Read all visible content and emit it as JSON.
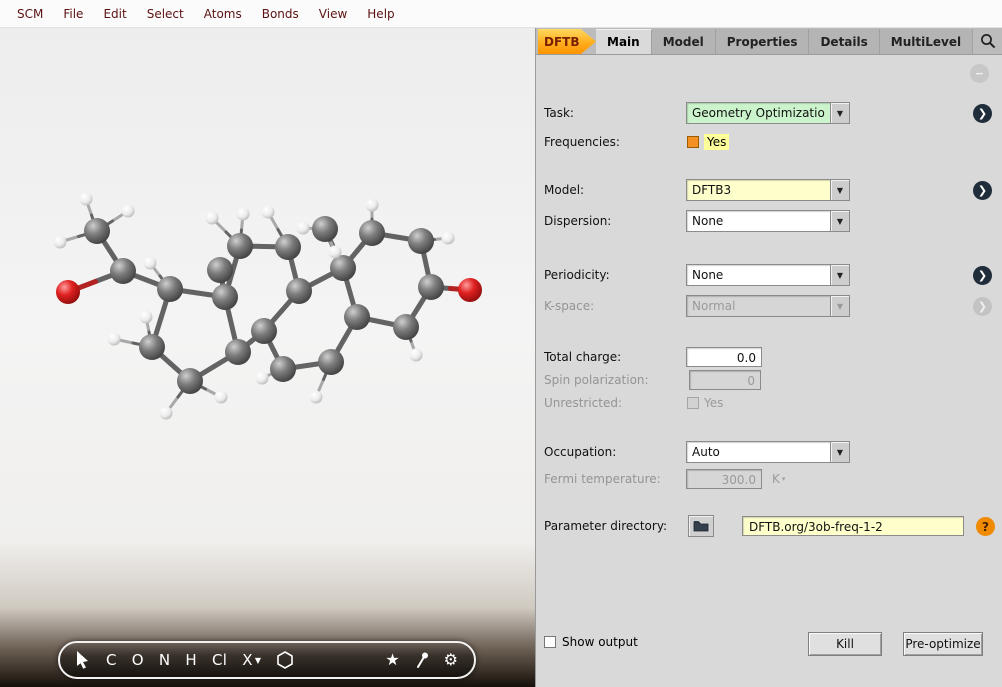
{
  "menu": {
    "items": [
      "SCM",
      "File",
      "Edit",
      "Select",
      "Atoms",
      "Bonds",
      "View",
      "Help"
    ]
  },
  "tabs": {
    "dftb_label": "DFTB",
    "items": [
      {
        "label": "Main",
        "active": true
      },
      {
        "label": "Model",
        "active": false
      },
      {
        "label": "Properties",
        "active": false
      },
      {
        "label": "Details",
        "active": false
      },
      {
        "label": "MultiLevel",
        "active": false
      }
    ]
  },
  "form": {
    "task": {
      "label": "Task:",
      "value": "Geometry Optimizatio"
    },
    "frequencies": {
      "label": "Frequencies:",
      "value": "Yes",
      "checked": true
    },
    "model": {
      "label": "Model:",
      "value": "DFTB3"
    },
    "dispersion": {
      "label": "Dispersion:",
      "value": "None"
    },
    "periodicity": {
      "label": "Periodicity:",
      "value": "None"
    },
    "kspace": {
      "label": "K-space:",
      "value": "Normal",
      "disabled": true
    },
    "total_charge": {
      "label": "Total charge:",
      "value": "0.0"
    },
    "spin_polarization": {
      "label": "Spin polarization:",
      "value": "0",
      "disabled": true
    },
    "unrestricted": {
      "label": "Unrestricted:",
      "value": "Yes",
      "disabled": true
    },
    "occupation": {
      "label": "Occupation:",
      "value": "Auto"
    },
    "fermi_temperature": {
      "label": "Fermi temperature:",
      "value": "300.0",
      "unit": "K",
      "disabled": true
    },
    "parameter_directory": {
      "label": "Parameter directory:",
      "value": "DFTB.org/3ob-freq-1-2"
    },
    "show_output": {
      "label": "Show output",
      "checked": false
    },
    "buttons": {
      "kill": "Kill",
      "preoptimize": "Pre-optimize"
    }
  },
  "toolbar": {
    "elements": [
      "C",
      "O",
      "N",
      "H",
      "Cl"
    ],
    "x_label": "X"
  },
  "colors": {
    "accent_orange": "#ff9400",
    "highlight_yellow": "#ffff99",
    "entry_green": "#ccf4cc",
    "entry_yellow": "#ffffcc",
    "carbon": "#5a5a5a",
    "hydrogen": "#f2f2f2",
    "oxygen": "#c01818"
  },
  "molecule": {
    "atoms": [
      [
        "C",
        97,
        203
      ],
      [
        "C",
        123,
        243
      ],
      [
        "O",
        68,
        264
      ],
      [
        "C",
        170,
        261
      ],
      [
        "C",
        152,
        319
      ],
      [
        "C",
        190,
        353
      ],
      [
        "C",
        238,
        324
      ],
      [
        "C",
        225,
        269
      ],
      [
        "C",
        240,
        218
      ],
      [
        "C",
        288,
        219
      ],
      [
        "C",
        299,
        263
      ],
      [
        "C",
        264,
        303
      ],
      [
        "C",
        343,
        240
      ],
      [
        "C",
        325,
        201
      ],
      [
        "C",
        372,
        205
      ],
      [
        "C",
        421,
        213
      ],
      [
        "C",
        431,
        259
      ],
      [
        "O",
        470,
        262
      ],
      [
        "C",
        406,
        299
      ],
      [
        "C",
        357,
        289
      ],
      [
        "C",
        331,
        334
      ],
      [
        "C",
        283,
        341
      ],
      [
        "C",
        220,
        242
      ],
      [
        "H",
        60,
        214
      ],
      [
        "H",
        86,
        171
      ],
      [
        "H",
        128,
        183
      ],
      [
        "H",
        150,
        235
      ],
      [
        "H",
        114,
        311
      ],
      [
        "H",
        146,
        289
      ],
      [
        "H",
        166,
        385
      ],
      [
        "H",
        221,
        369
      ],
      [
        "H",
        262,
        350
      ],
      [
        "H",
        316,
        369
      ],
      [
        "H",
        416,
        327
      ],
      [
        "H",
        448,
        210
      ],
      [
        "H",
        372,
        177
      ],
      [
        "H",
        212,
        190
      ],
      [
        "H",
        243,
        186
      ],
      [
        "H",
        268,
        184
      ],
      [
        "H",
        303,
        200
      ],
      [
        "H",
        335,
        224
      ]
    ],
    "bonds": [
      [
        0,
        1
      ],
      [
        1,
        2
      ],
      [
        1,
        3
      ],
      [
        3,
        4
      ],
      [
        4,
        5
      ],
      [
        5,
        6
      ],
      [
        6,
        7
      ],
      [
        7,
        3
      ],
      [
        7,
        8
      ],
      [
        8,
        9
      ],
      [
        9,
        10
      ],
      [
        10,
        11
      ],
      [
        11,
        6
      ],
      [
        10,
        12
      ],
      [
        12,
        13
      ],
      [
        12,
        14
      ],
      [
        14,
        15
      ],
      [
        15,
        16
      ],
      [
        16,
        17
      ],
      [
        16,
        18
      ],
      [
        18,
        19
      ],
      [
        19,
        12
      ],
      [
        19,
        20
      ],
      [
        20,
        21
      ],
      [
        21,
        11
      ],
      [
        7,
        22
      ],
      [
        23,
        0
      ],
      [
        24,
        0
      ],
      [
        25,
        0
      ],
      [
        26,
        3
      ],
      [
        27,
        4
      ],
      [
        28,
        4
      ],
      [
        29,
        5
      ],
      [
        30,
        5
      ],
      [
        31,
        21
      ],
      [
        32,
        20
      ],
      [
        33,
        18
      ],
      [
        34,
        15
      ],
      [
        35,
        14
      ],
      [
        36,
        8
      ],
      [
        37,
        8
      ],
      [
        38,
        9
      ],
      [
        39,
        13
      ],
      [
        40,
        13
      ]
    ]
  }
}
